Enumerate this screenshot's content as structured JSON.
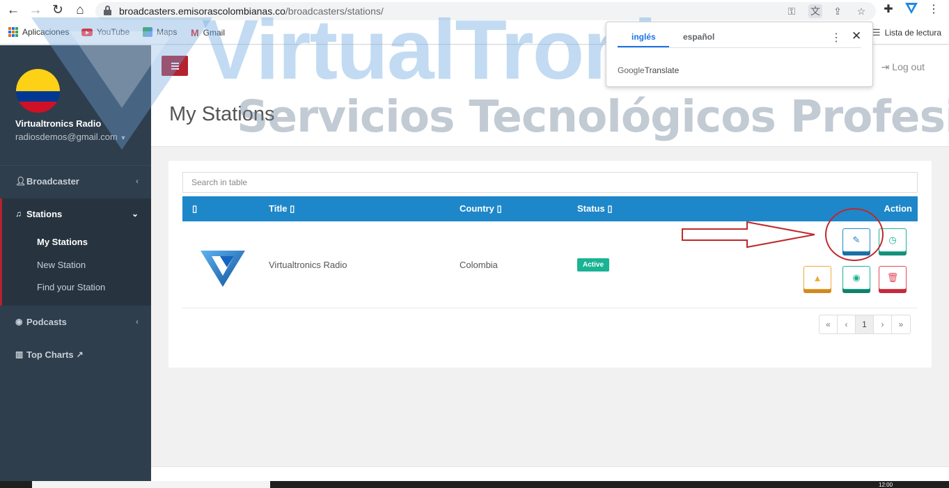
{
  "browser": {
    "url_domain": "broadcasters.emisorascolombianas.co",
    "url_path": "/broadcasters/stations/",
    "bookmarks": [
      "Aplicaciones",
      "YouTube",
      "Maps",
      "Gmail"
    ],
    "reading_list": "Lista de lectura"
  },
  "translate_popup": {
    "tab_selected": "inglés",
    "tab_other": "español",
    "brand_google": "Google",
    "brand_translate": "Translate"
  },
  "watermark": {
    "brand": "VirtualTronics",
    "tagline": "Servicios Tecnológicos Profesionales"
  },
  "sidebar": {
    "user_name": "Virtualtronics Radio",
    "user_email": "radiosdemos@gmail.com",
    "menu": [
      {
        "label": "Broadcaster",
        "icon": "user-icon"
      },
      {
        "label": "Stations",
        "icon": "music-icon",
        "expanded": true
      },
      {
        "label": "Podcasts",
        "icon": "podcast-icon"
      },
      {
        "label": "Top Charts",
        "icon": "bar-chart-icon"
      }
    ],
    "stations_sub": [
      "My Stations",
      "New Station",
      "Find your Station"
    ]
  },
  "header": {
    "logout": "Log out",
    "page_title": "My Stations",
    "accent": "#b4232f"
  },
  "table": {
    "search_placeholder": "Search in table",
    "header_color": "#1e87c9",
    "columns": [
      "Title",
      "Country",
      "Status",
      "Action"
    ],
    "rows": [
      {
        "title": "Virtualtronics Radio",
        "country": "Colombia",
        "status": "Active"
      }
    ],
    "pagination": [
      "«",
      "‹",
      "1",
      "›",
      "»"
    ]
  },
  "taskbar": {
    "clock": "12:00"
  }
}
